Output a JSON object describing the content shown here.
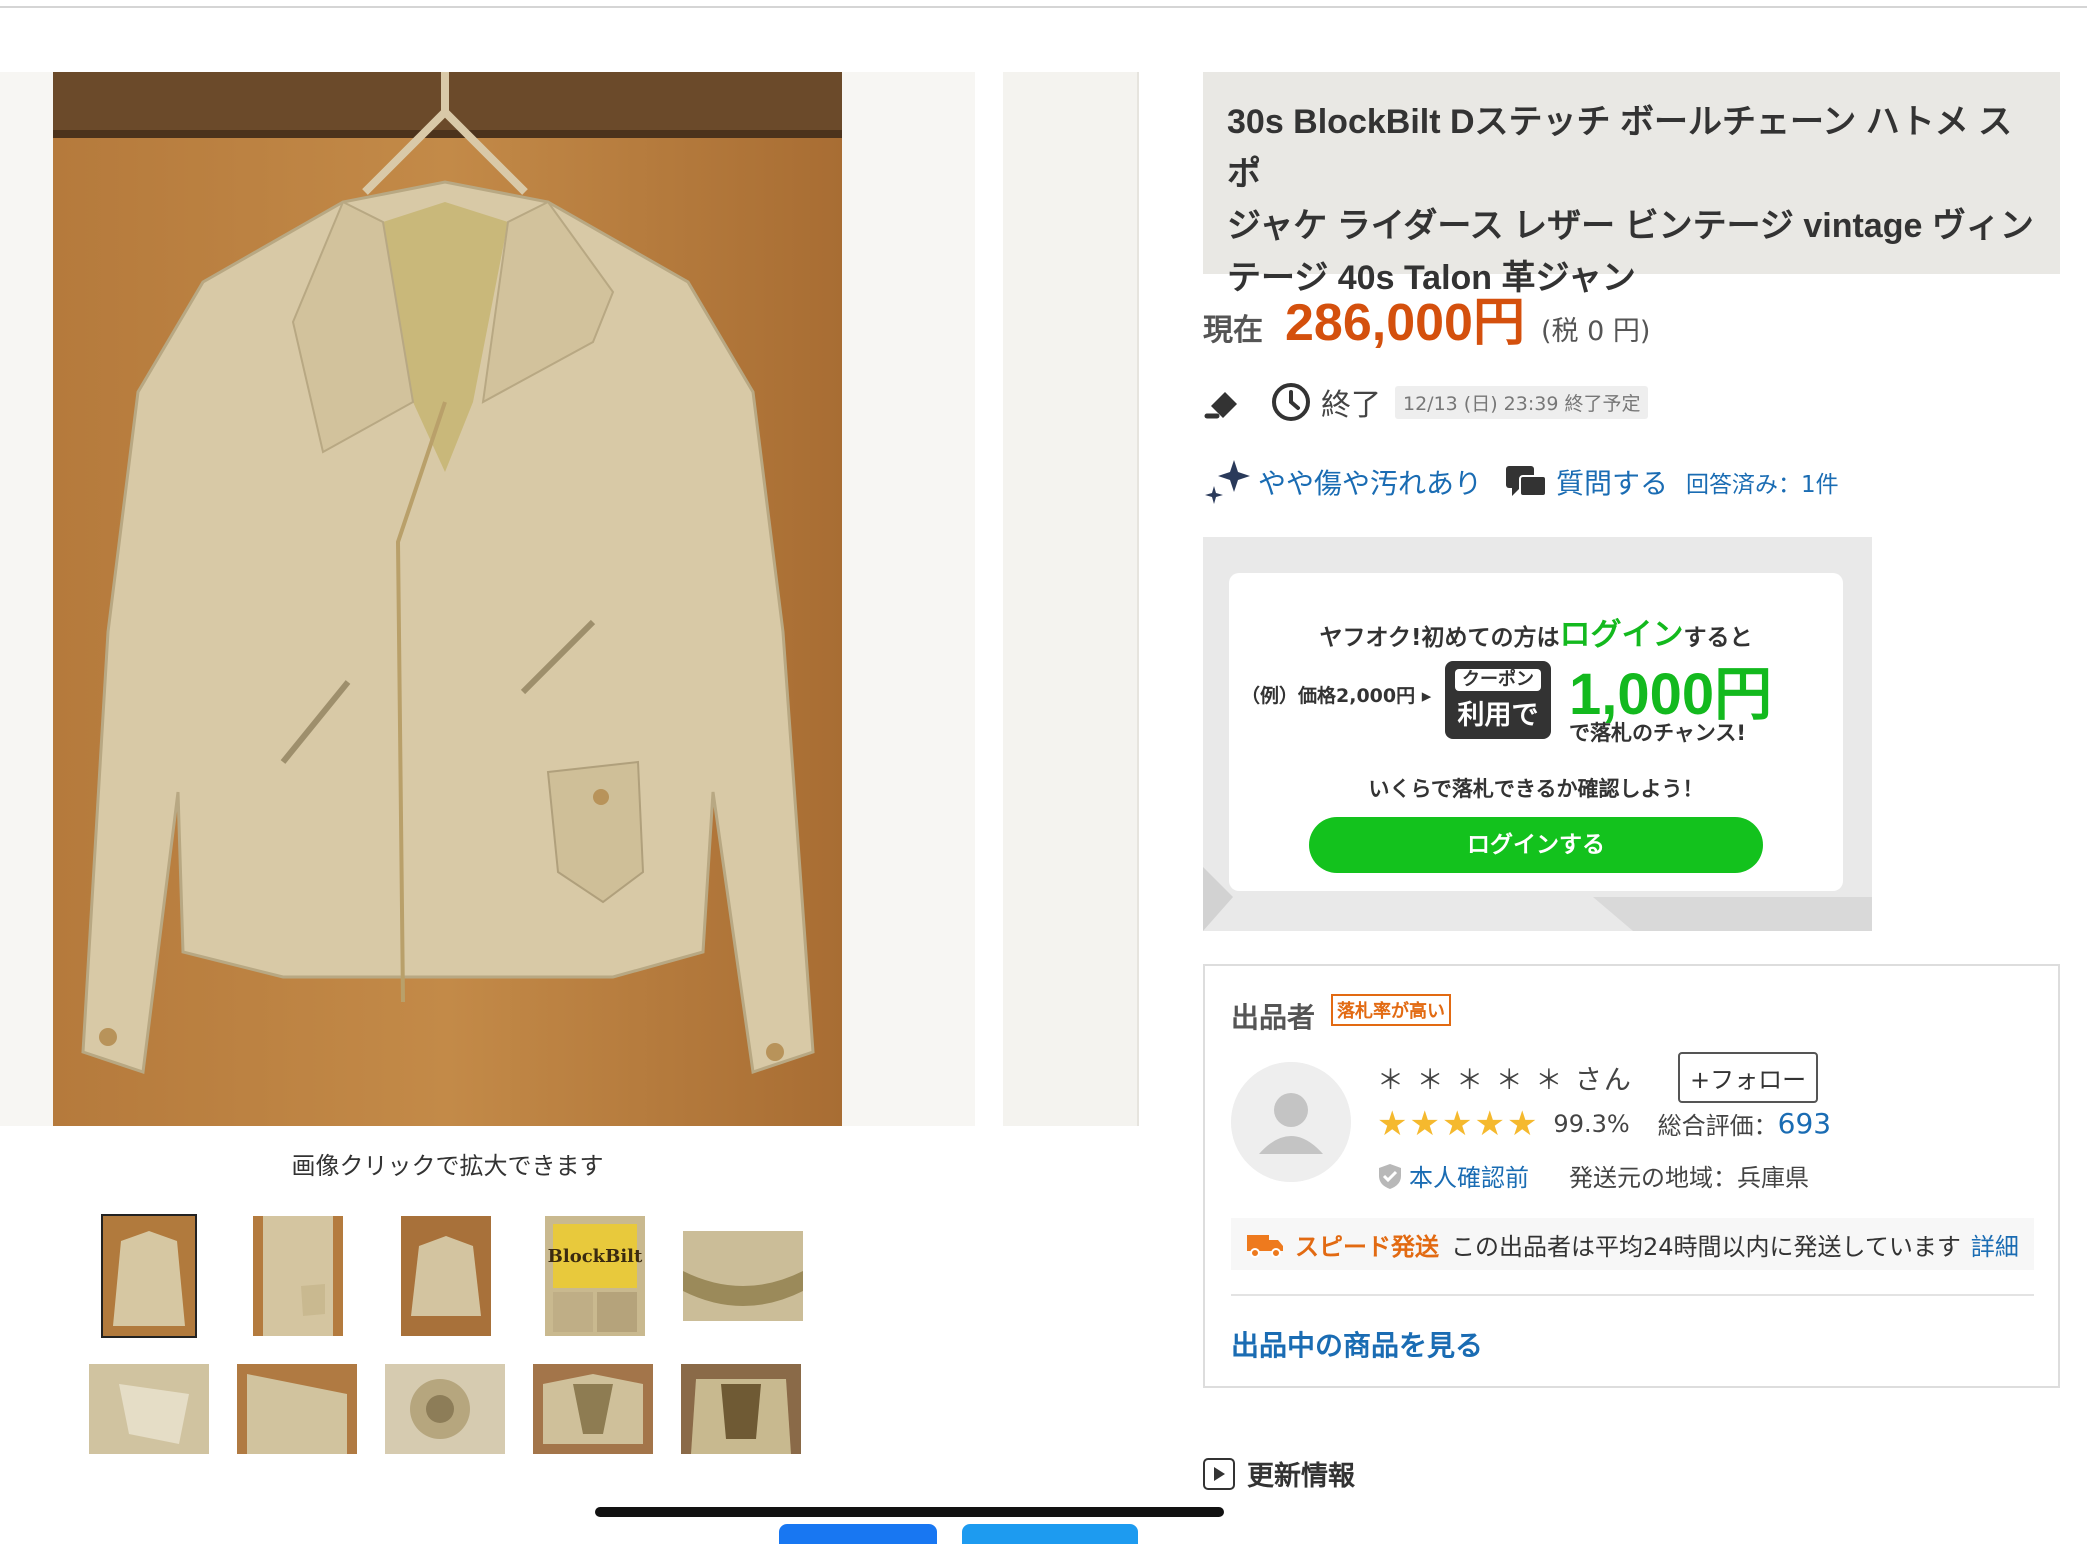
{
  "gallery": {
    "caption": "画像クリックで拡大できます",
    "thumbnail_count": 10,
    "thumb_label_text": "BlockBilt"
  },
  "item": {
    "title_lines": [
      "30s BlockBilt Dステッチ ボールチェーン ハトメ スポ",
      "ジャケ ライダース レザー ビンテージ vintage ヴィン",
      "テージ 40s Talon 革ジャン"
    ],
    "price_label": "現在",
    "price": "286,000円",
    "tax": "(税 0 円)",
    "end_label": "終了",
    "end_time": "12/13 (日) 23:39 終了予定",
    "condition": "やや傷や汚れあり",
    "ask": "質問する",
    "answered": "回答済み：1件"
  },
  "banner": {
    "line1_pre": "ヤフオク!初めての方は",
    "line1_login": "ログイン",
    "line1_post": "すると",
    "example": "（例）価格2,000円",
    "coupon_top": "クーポン",
    "coupon_bottom": "利用で",
    "amount": "1,000円",
    "chance": "で落札のチャンス!",
    "confirm": "いくらで落札できるか確認しよう！",
    "button": "ログインする"
  },
  "seller": {
    "heading": "出品者",
    "badge": "落札率が高い",
    "name": "＊ ＊ ＊ ＊ ＊ さん",
    "follow": "+フォロー",
    "rating_stars": 5,
    "rate": "99.3%",
    "total_label": "総合評価：",
    "total_value": "693",
    "verify": "本人確認前",
    "location": "発送元の地域：兵庫県",
    "speed_title": "スピード発送",
    "speed_text": "この出品者は平均24時間以内に発送しています",
    "speed_detail": "詳細",
    "items_link": "出品中の商品を見る"
  },
  "update": {
    "label": "更新情報"
  },
  "colors": {
    "price": "#d4500d",
    "link": "#1a6cb3",
    "login_green": "#13c21d",
    "star": "#f5b92e",
    "badge_orange": "#e26a12",
    "title_bg": "#e9e8e4"
  }
}
